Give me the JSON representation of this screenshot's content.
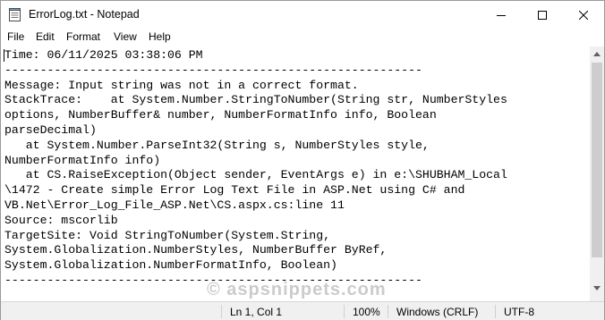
{
  "window": {
    "title": "ErrorLog.txt - Notepad"
  },
  "menu": [
    "File",
    "Edit",
    "Format",
    "View",
    "Help"
  ],
  "editor": {
    "lines": [
      "Time: 06/11/2025 03:38:06 PM",
      "-----------------------------------------------------------",
      "Message: Input string was not in a correct format.",
      "StackTrace:    at System.Number.StringToNumber(String str, NumberStyles",
      "options, NumberBuffer& number, NumberFormatInfo info, Boolean",
      "parseDecimal)",
      "   at System.Number.ParseInt32(String s, NumberStyles style,",
      "NumberFormatInfo info)",
      "   at CS.RaiseException(Object sender, EventArgs e) in e:\\SHUBHAM_Local",
      "\\1472 - Create simple Error Log Text File in ASP.Net using C# and",
      "VB.Net\\Error_Log_File_ASP.Net\\CS.aspx.cs:line 11",
      "Source: mscorlib",
      "TargetSite: Void StringToNumber(System.String,",
      "System.Globalization.NumberStyles, NumberBuffer ByRef,",
      "System.Globalization.NumberFormatInfo, Boolean)",
      "-----------------------------------------------------------"
    ]
  },
  "status": {
    "position": "Ln 1, Col 1",
    "zoom": "100%",
    "line_ending": "Windows (CRLF)",
    "encoding": "UTF-8"
  },
  "watermark": "© aspsnippets.com"
}
